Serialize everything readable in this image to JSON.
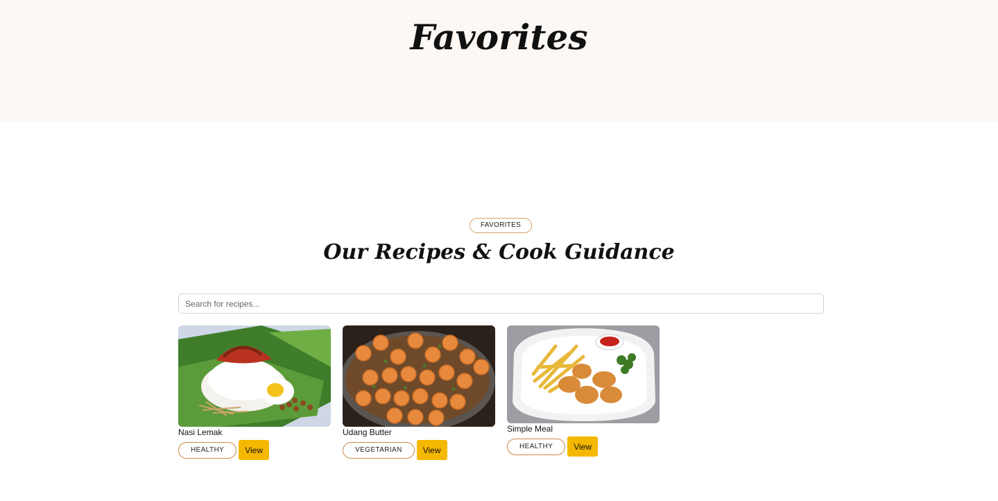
{
  "hero": {
    "title": "Favorites"
  },
  "section": {
    "badge": "FAVORITES",
    "title": "Our Recipes & Cook Guidance"
  },
  "search": {
    "placeholder": "Search for recipes...",
    "value": ""
  },
  "recipes": [
    {
      "name": "Nasi Lemak",
      "tag": "HEALTHY",
      "action": "View"
    },
    {
      "name": "Udang Butter",
      "tag": "VEGETARIAN",
      "action": "View"
    },
    {
      "name": "Simple Meal",
      "tag": "HEALTHY",
      "action": "View"
    }
  ],
  "colors": {
    "hero_bg": "#fef8f4",
    "accent": "#f5b800",
    "tag_border": "#c9894b"
  }
}
